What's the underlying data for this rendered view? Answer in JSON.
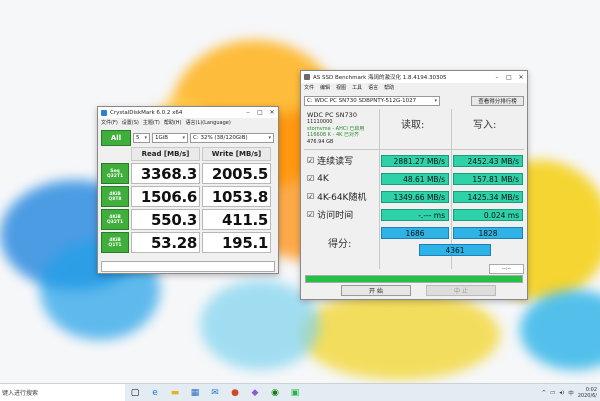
{
  "crystaldiskmark": {
    "title": "CrystalDiskMark 6.0.2 x64",
    "menu": [
      "文件(F)",
      "设置(S)",
      "主题(T)",
      "帮助(H)",
      "语言(L)(Language)"
    ],
    "all_label": "All",
    "count": "5",
    "size": "1GiB",
    "drive": "C: 32% (38/120GiB)",
    "read_header": "Read [MB/s]",
    "write_header": "Write [MB/s]",
    "rows": [
      {
        "l1": "Seq",
        "l2": "Q32T1",
        "read": "3368.3",
        "write": "2005.5"
      },
      {
        "l1": "4KiB",
        "l2": "Q8T8",
        "read": "1506.6",
        "write": "1053.8"
      },
      {
        "l1": "4KiB",
        "l2": "Q32T1",
        "read": "550.3",
        "write": "411.5"
      },
      {
        "l1": "4KiB",
        "l2": "Q1T1",
        "read": "53.28",
        "write": "195.1"
      }
    ]
  },
  "asssd": {
    "title": "AS SSD Benchmark 海阔的激汉化 1.8.4194.30305",
    "menu": [
      "文件",
      "编辑",
      "视图",
      "工具",
      "语言",
      "帮助"
    ],
    "drive_select": "C: WDC PC SN730 SDBPNTY-512G-1027",
    "copy_button": "查看得分排行榜",
    "drive_info": {
      "name": "WDC PC SN730",
      "firmware": "11110000",
      "driver": "stornvme - AHCI 已启用",
      "align": "116608 K - 4K 已对齐",
      "size": "476.94 GB"
    },
    "read_header": "读取:",
    "write_header": "写入:",
    "tests": [
      {
        "label": "连续读写",
        "read": "2881.27 MB/s",
        "write": "2452.43 MB/s"
      },
      {
        "label": "4K",
        "read": "48.61 MB/s",
        "write": "157.81 MB/s"
      },
      {
        "label": "4K-64K随机",
        "read": "1349.66 MB/s",
        "write": "1425.34 MB/s"
      },
      {
        "label": "访问时间",
        "read": "-.--- ms",
        "write": "0.024 ms"
      }
    ],
    "score_label": "得分:",
    "score_read": "1686",
    "score_write": "1828",
    "score_total": "4361",
    "progress_box": "--:--",
    "progress_fraction": 1.0,
    "start_button": "开 始",
    "abort_button": "中 止",
    "accent_color": "#2dd2a8",
    "score_color": "#2fb3e6"
  },
  "taskbar": {
    "search_text": "键入进行搜索",
    "time": "0:02",
    "date": "2020/6/",
    "ime": "中",
    "icons": [
      "task-view-icon",
      "edge-icon",
      "file-explorer-icon",
      "store-icon",
      "mail-icon",
      "powerpoint-icon",
      "photos-icon",
      "xbox-icon",
      "chart-app-icon"
    ]
  }
}
